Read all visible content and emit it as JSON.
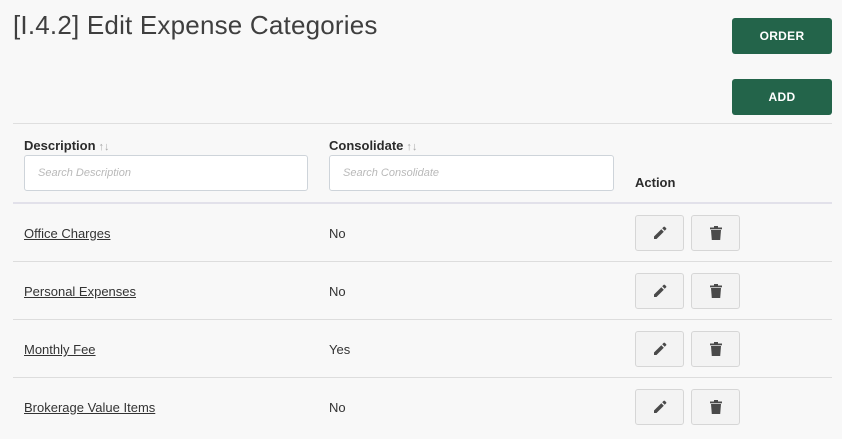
{
  "header": {
    "title": "[I.4.2] Edit Expense Categories",
    "order_label": "ORDER",
    "add_label": "ADD"
  },
  "table": {
    "columns": {
      "description": "Description",
      "consolidate": "Consolidate",
      "action": "Action",
      "sort_icon": "sort-arrows-icon"
    },
    "filters": {
      "description_placeholder": "Search Description",
      "consolidate_placeholder": "Search Consolidate"
    },
    "rows": [
      {
        "description": "Office Charges",
        "consolidate": "No"
      },
      {
        "description": "Personal Expenses",
        "consolidate": "No"
      },
      {
        "description": "Monthly Fee",
        "consolidate": "Yes"
      },
      {
        "description": "Brokerage Value Items",
        "consolidate": "No"
      }
    ]
  },
  "colors": {
    "primary_button": "#23644a",
    "background": "#f8f8f8",
    "icon": "#4a4a4a"
  }
}
